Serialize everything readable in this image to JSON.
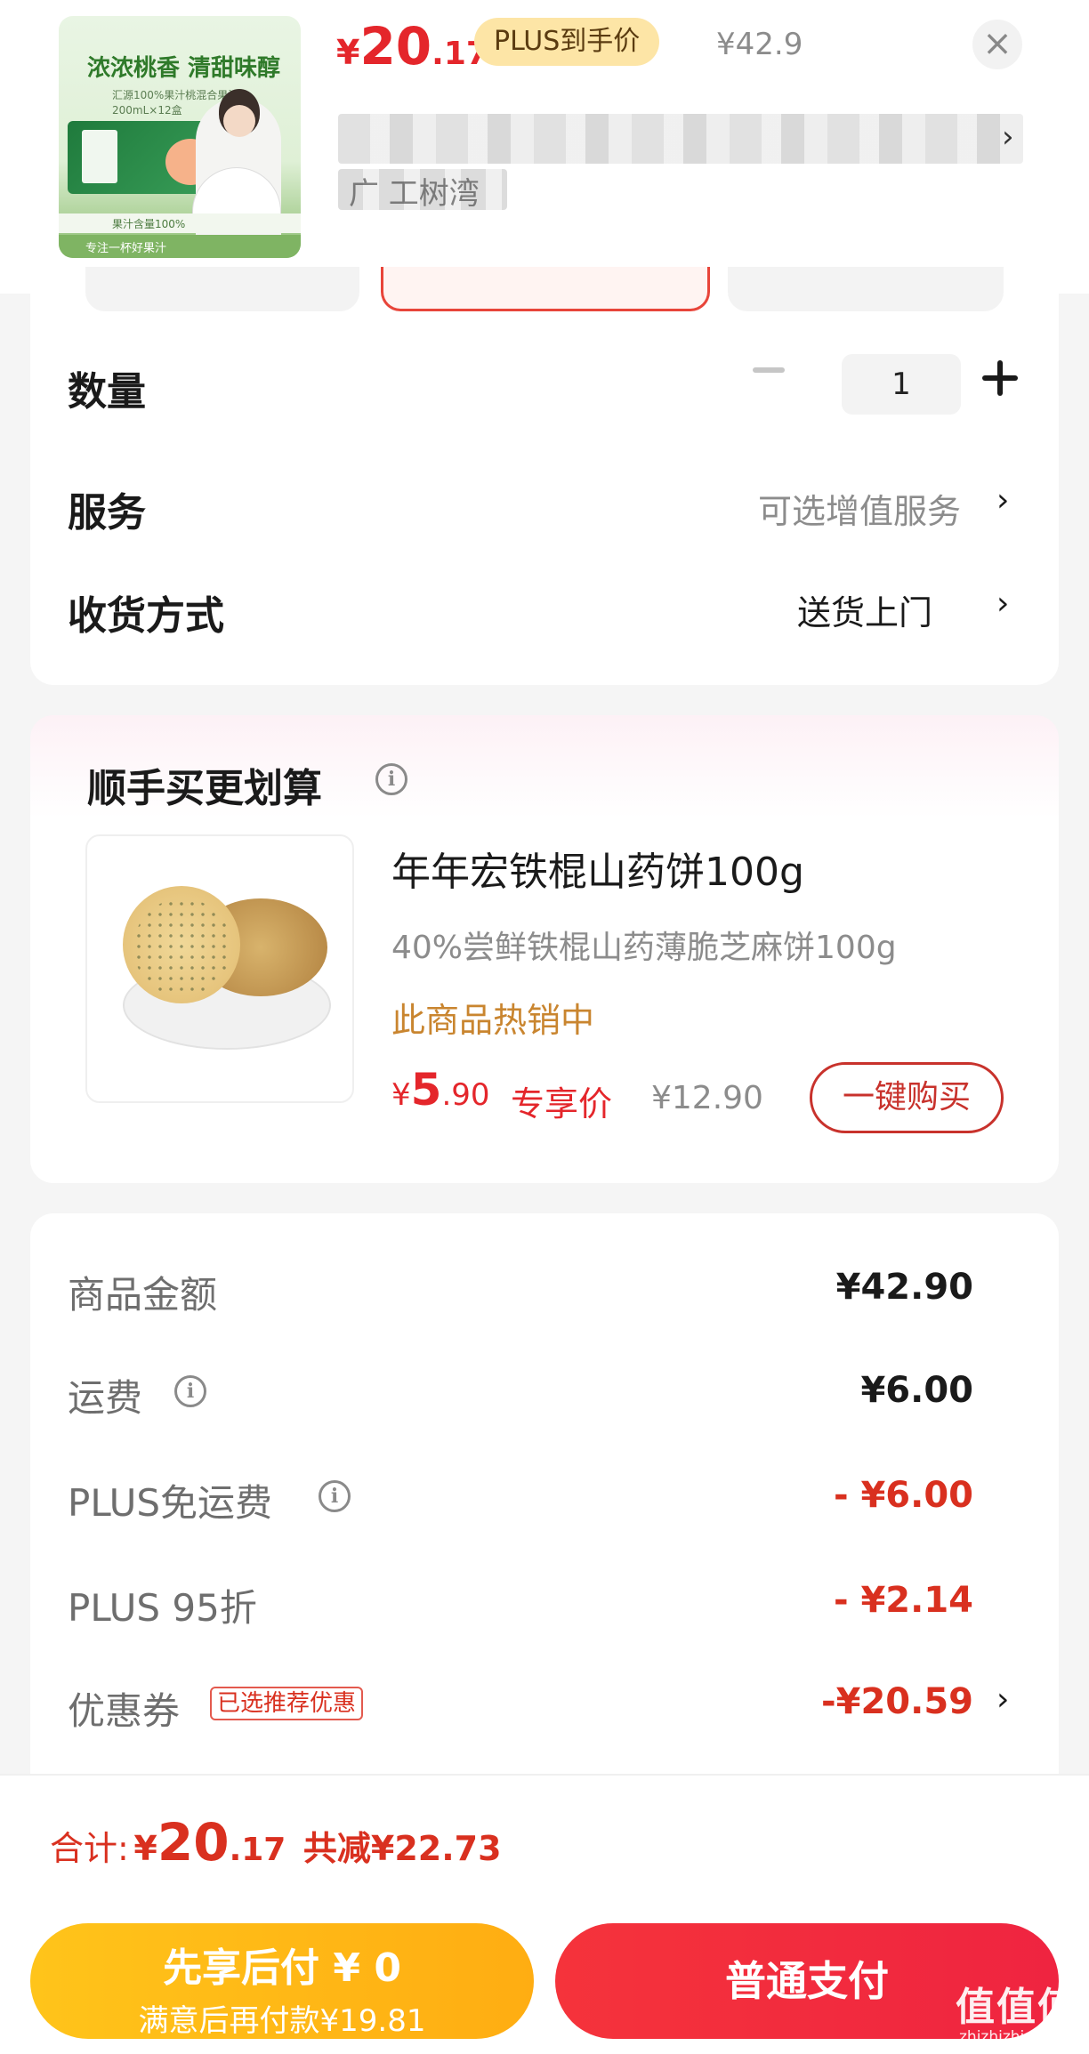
{
  "header": {
    "product_image": {
      "headline": "浓浓桃香 清甜味醇",
      "subline": "汇源100%果汁桃混合果汁 200mL×12盒",
      "strip1": "果汁含量100%",
      "strip2": "专注一杯好果汁"
    },
    "price": {
      "currency": "¥",
      "integer": "20",
      "decimal": ".17"
    },
    "plus_chip": "PLUS到手价",
    "original_price": "¥42.9",
    "close_symbol": "×",
    "address_partial": "广 工树湾"
  },
  "options": {
    "quantity_label": "数量",
    "quantity_value": "1",
    "service_label": "服务",
    "service_value": "可选增值服务",
    "delivery_label": "收货方式",
    "delivery_value": "送货上门",
    "chevron": "›"
  },
  "addon": {
    "title": "顺手买更划算",
    "info_symbol": "i",
    "name": "年年宏铁棍山药饼100g",
    "desc": "40%尝鲜铁棍山药薄脆芝麻饼100g",
    "hot": "此商品热销中",
    "price": {
      "currency": "¥",
      "integer": "5",
      "decimal": ".90"
    },
    "exclusive_label": "专享价",
    "original_price": "¥12.90",
    "buy_button": "一键购买"
  },
  "summary": {
    "goods_label": "商品金额",
    "goods_value": "¥42.90",
    "shipping_label": "运费",
    "shipping_value": "¥6.00",
    "plus_free_shipping_label": "PLUS免运费",
    "plus_free_shipping_value": "- ¥6.00",
    "plus_discount_label": "PLUS 95折",
    "plus_discount_value": "- ¥2.14",
    "coupon_label": "优惠券",
    "coupon_tag": "已选推荐优惠",
    "coupon_value": "-¥20.59"
  },
  "total": {
    "label": "合计:",
    "currency": "¥",
    "integer": "20",
    "decimal": ".17",
    "saved": "共减¥22.73"
  },
  "buttons": {
    "pay_later_line1": "先享后付 ¥ 0",
    "pay_later_line2": "满意后再付款¥19.81",
    "pay_now": "普通支付"
  },
  "watermark": {
    "logo": "值值值",
    "domain": "zhizhizhi.com"
  },
  "colors": {
    "accent_red": "#e4262b",
    "plus_gold": "#fde5a6",
    "pay_later_yellow": "#ffb812",
    "hot_orange": "#c9852f"
  }
}
